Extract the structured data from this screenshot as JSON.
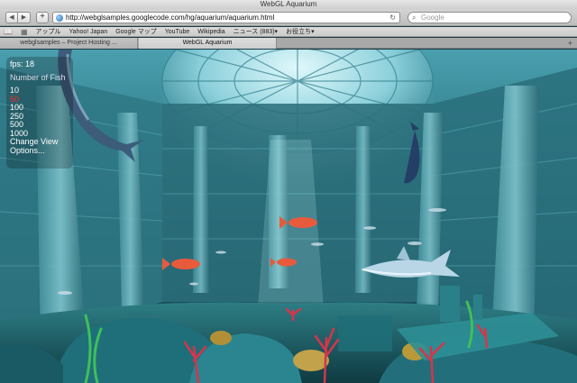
{
  "window": {
    "title": "WebGL Aquarium"
  },
  "toolbar": {
    "back_icon": "chevron-left-icon",
    "forward_icon": "chevron-right-icon",
    "add_label": "+",
    "url": "http://webglsamples.googlecode.com/hg/aquarium/aquarium.html",
    "reload_icon": "reload-icon",
    "search_placeholder": "Google"
  },
  "bookmarks": {
    "items": [
      "アップル",
      "Yahoo! Japan",
      "Google マップ",
      "YouTube",
      "Wikipedia",
      "ニュース (883)▾",
      "お役立ち▾"
    ]
  },
  "tabs": [
    {
      "label": "webglsamples – Project Hosting ...",
      "active": false
    },
    {
      "label": "WebGL Aquarium",
      "active": true
    }
  ],
  "overlay": {
    "fps": "fps: 18",
    "number_of_fish_label": "Number of Fish",
    "fish_options": [
      "10",
      "50",
      "100",
      "250",
      "500",
      "1000"
    ],
    "selected_fish": "50",
    "change_view": "Change View",
    "options": "Options..."
  },
  "colors": {
    "water_light": "#9fe0ea",
    "water_dark": "#143e48",
    "selected_option": "#ff2a2a",
    "coral": "#d8344a"
  }
}
